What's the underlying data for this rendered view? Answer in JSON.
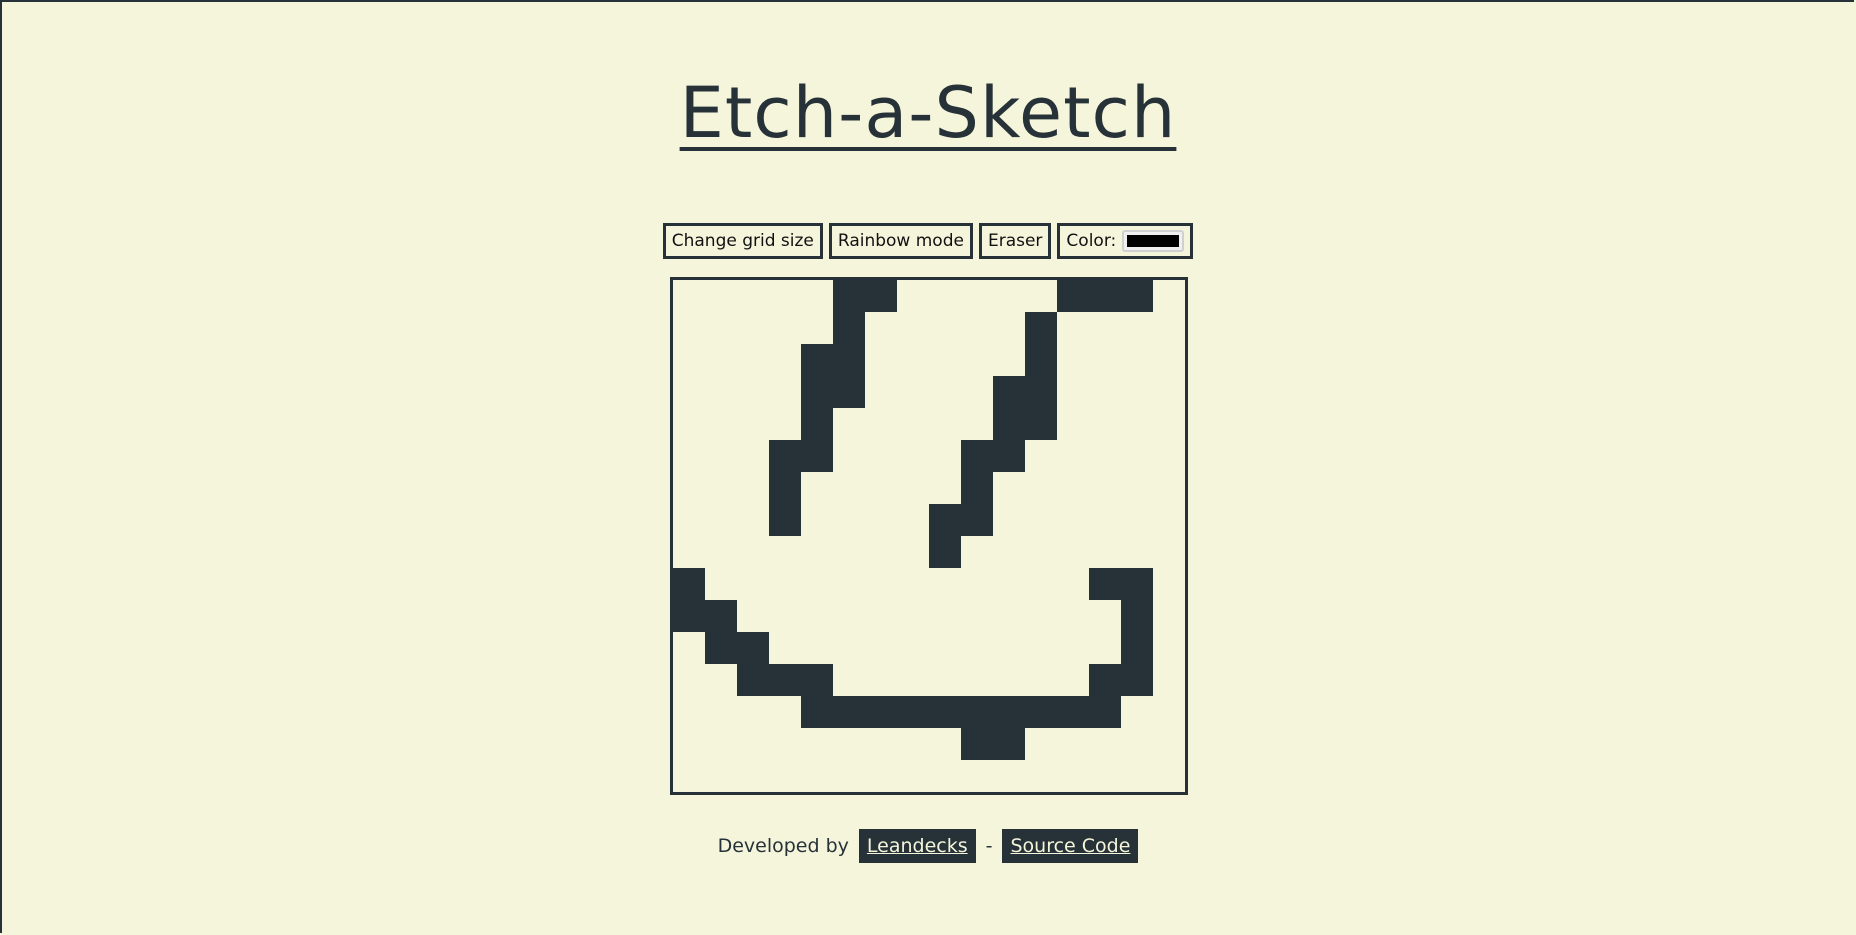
{
  "title": "Etch-a-Sketch",
  "toolbar": {
    "grid_size_label": "Change grid size",
    "rainbow_label": "Rainbow mode",
    "eraser_label": "Eraser",
    "color_label": "Color:",
    "color_value": "#000000"
  },
  "grid": {
    "size": 16,
    "ink_color": "#263238",
    "filled_cells": [
      [
        0,
        5
      ],
      [
        0,
        6
      ],
      [
        0,
        12
      ],
      [
        0,
        13
      ],
      [
        0,
        14
      ],
      [
        1,
        5
      ],
      [
        1,
        11
      ],
      [
        2,
        4
      ],
      [
        2,
        5
      ],
      [
        2,
        11
      ],
      [
        3,
        4
      ],
      [
        3,
        5
      ],
      [
        3,
        10
      ],
      [
        3,
        11
      ],
      [
        4,
        4
      ],
      [
        4,
        10
      ],
      [
        4,
        11
      ],
      [
        5,
        3
      ],
      [
        5,
        4
      ],
      [
        5,
        9
      ],
      [
        5,
        10
      ],
      [
        6,
        3
      ],
      [
        6,
        9
      ],
      [
        7,
        3
      ],
      [
        7,
        8
      ],
      [
        7,
        9
      ],
      [
        8,
        8
      ],
      [
        9,
        0
      ],
      [
        9,
        13
      ],
      [
        9,
        14
      ],
      [
        10,
        0
      ],
      [
        10,
        1
      ],
      [
        10,
        14
      ],
      [
        11,
        1
      ],
      [
        11,
        2
      ],
      [
        11,
        14
      ],
      [
        12,
        2
      ],
      [
        12,
        3
      ],
      [
        12,
        4
      ],
      [
        12,
        13
      ],
      [
        12,
        14
      ],
      [
        13,
        4
      ],
      [
        13,
        5
      ],
      [
        13,
        6
      ],
      [
        13,
        7
      ],
      [
        13,
        8
      ],
      [
        13,
        9
      ],
      [
        13,
        10
      ],
      [
        13,
        11
      ],
      [
        13,
        12
      ],
      [
        13,
        13
      ],
      [
        14,
        9
      ],
      [
        14,
        10
      ]
    ]
  },
  "footer": {
    "developed_by": "Developed by",
    "author_link": "Leandecks",
    "separator": "-",
    "source_link": "Source Code"
  }
}
